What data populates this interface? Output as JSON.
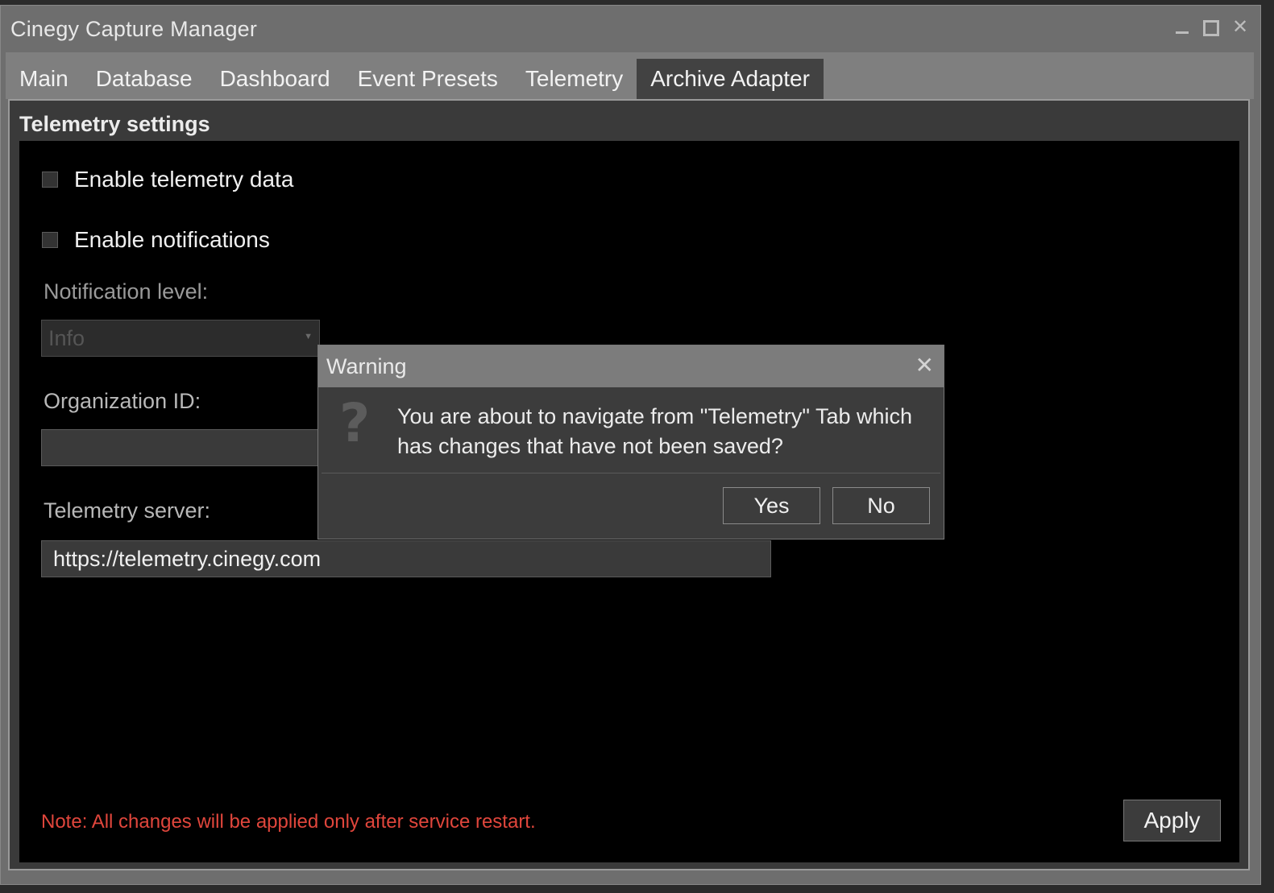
{
  "window": {
    "title": "Cinegy Capture Manager",
    "controls": {
      "minimize_icon": "minimize-icon",
      "maximize_icon": "maximize-icon",
      "close_label": "✕"
    }
  },
  "tabs": [
    {
      "label": "Main"
    },
    {
      "label": "Database"
    },
    {
      "label": "Dashboard"
    },
    {
      "label": "Event Presets"
    },
    {
      "label": "Telemetry"
    },
    {
      "label": "Archive Adapter",
      "active": true
    }
  ],
  "telemetry": {
    "group_title": "Telemetry settings",
    "enable_telemetry": {
      "label": "Enable telemetry data",
      "checked": false
    },
    "enable_notifications": {
      "label": "Enable notifications",
      "checked": false
    },
    "notification_level": {
      "label": "Notification level:",
      "value": "Info",
      "disabled": true
    },
    "organization_id": {
      "label": "Organization ID:",
      "value": ""
    },
    "server": {
      "label": "Telemetry server:",
      "value": "https://telemetry.cinegy.com"
    },
    "note": "Note: All changes will be applied only after service restart.",
    "apply_label": "Apply"
  },
  "dialog": {
    "title": "Warning",
    "close_label": "✕",
    "icon": "question-icon",
    "message": "You are about to navigate from \"Telemetry\" Tab which has changes that have not been saved?",
    "yes_label": "Yes",
    "no_label": "No"
  },
  "colors": {
    "note_red": "#e0463c",
    "window_chrome": "#6e6e6e",
    "panel_black": "#000000"
  }
}
